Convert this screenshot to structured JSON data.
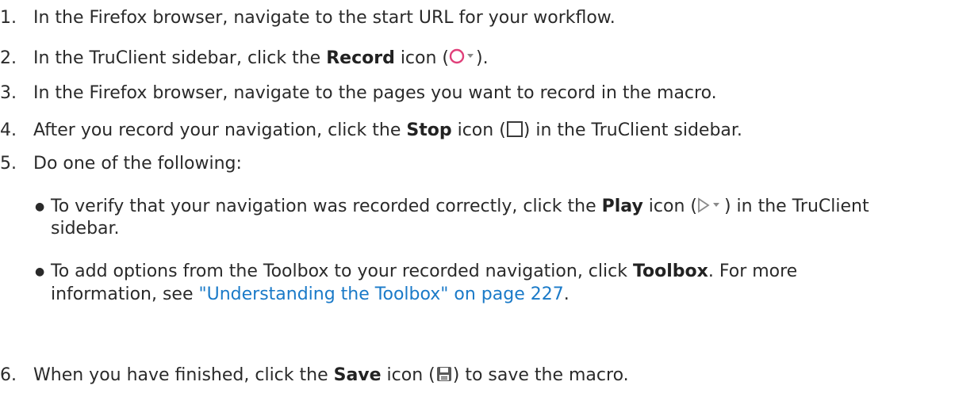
{
  "steps": [
    {
      "number": "1.",
      "text": "In the Firefox browser, navigate to the start URL for your workflow."
    },
    {
      "number": "2.",
      "pre": "In the TruClient sidebar, click the ",
      "keyword": "Record",
      "mid": " icon (",
      "icon": "record-icon",
      "post": ")."
    },
    {
      "number": "3.",
      "text": "In the Firefox browser, navigate to the pages you want to record in the macro."
    },
    {
      "number": "4.",
      "pre": "After you record your navigation, click the ",
      "keyword": "Stop",
      "mid": " icon (",
      "icon": "stop-icon",
      "post": ") in the TruClient sidebar."
    },
    {
      "number": "5.",
      "text": "Do one of the following:"
    },
    {
      "number": "6.",
      "pre": "When you have finished, click the ",
      "keyword": "Save",
      "mid": " icon (",
      "icon": "save-icon",
      "post": ") to save the macro."
    }
  ],
  "bullets": [
    {
      "pre": "To verify that your navigation was recorded correctly, click the ",
      "keyword": "Play",
      "mid": " icon (",
      "icon": "play-icon",
      "post": ") in the TruClient",
      "continuation": "sidebar."
    },
    {
      "pre": "To add options from the Toolbox to your recorded navigation, click ",
      "keyword": "Toolbox",
      "post": ". For more",
      "continuation_pre": "information, see ",
      "link": "\"Understanding the Toolbox\" on page 227",
      "continuation_post": "."
    }
  ],
  "colors": {
    "text": "#2a2a2a",
    "link": "#1a7ac8",
    "record_icon": "#e0407a",
    "icon_gray": "#8a8a8a"
  }
}
